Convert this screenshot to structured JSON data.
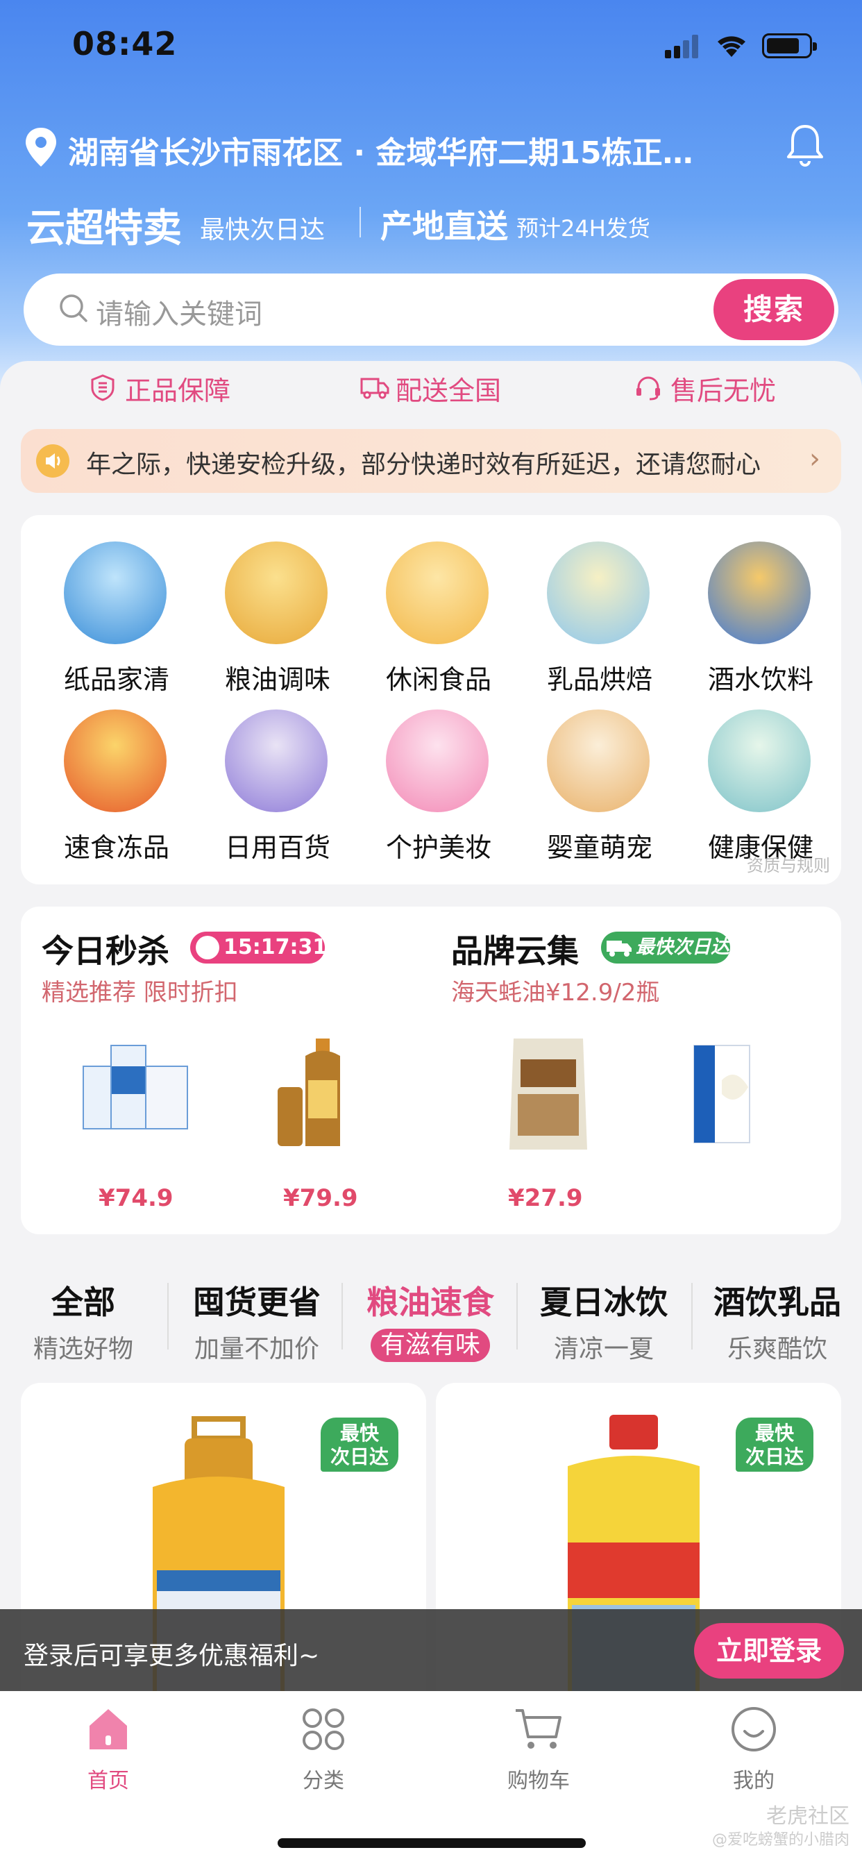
{
  "status_bar": {
    "time": "08:42"
  },
  "header": {
    "location": "湖南省长沙市雨花区 · 金域华府二期15栋正…",
    "brand_title": "云超特卖",
    "brand_sub": "最快次日达",
    "direct_title": "产地直送",
    "direct_sub": "预计24H发货"
  },
  "search": {
    "placeholder": "请输入关键词",
    "button": "搜索"
  },
  "guarantees": [
    "正品保障",
    "配送全国",
    "售后无忧"
  ],
  "notice": {
    "text": "年之际，快递安检升级，部分快递时效有所延迟，还请您耐心"
  },
  "categories": [
    {
      "label": "纸品家清",
      "icon": "tissue-icon",
      "color": "#3a8ed8"
    },
    {
      "label": "粮油调味",
      "icon": "oil-icon",
      "color": "#e8a93a"
    },
    {
      "label": "休闲食品",
      "icon": "snack-icon",
      "color": "#f3b84a"
    },
    {
      "label": "乳品烘焙",
      "icon": "cheese-icon",
      "color": "#8ec7ec"
    },
    {
      "label": "酒水饮料",
      "icon": "drink-icon",
      "color": "#3f79d6"
    },
    {
      "label": "速食冻品",
      "icon": "crayfish-icon",
      "color": "#e65a2b"
    },
    {
      "label": "日用百货",
      "icon": "pot-icon",
      "color": "#8e7bd8"
    },
    {
      "label": "个护美妆",
      "icon": "cosmetics-icon",
      "color": "#f38ab6"
    },
    {
      "label": "婴童萌宠",
      "icon": "diaper-icon",
      "color": "#e9b26b"
    },
    {
      "label": "健康保健",
      "icon": "mask-icon",
      "color": "#7fc3c9"
    }
  ],
  "categories_footer": "资质与规则",
  "deals": {
    "flash": {
      "title": "今日秒杀",
      "timer": "15:17:31",
      "sub": "精选推荐 限时折扣",
      "prices": [
        "¥74.9",
        "¥79.9"
      ]
    },
    "brand": {
      "title": "品牌云集",
      "badge": "最快次日达",
      "sub": "海天蚝油¥12.9/2瓶",
      "prices": [
        "¥27.9"
      ]
    }
  },
  "tabs": [
    {
      "title": "全部",
      "sub": "精选好物"
    },
    {
      "title": "囤货更省",
      "sub": "加量不加价"
    },
    {
      "title": "粮油速食",
      "sub": "有滋有味"
    },
    {
      "title": "夏日冰饮",
      "sub": "清凉一夏"
    },
    {
      "title": "酒饮乳品",
      "sub": "乐爽酷饮"
    }
  ],
  "product_badge": {
    "line1": "最快",
    "line2": "次日达"
  },
  "login_bar": {
    "text": "登录后可享更多优惠福利~",
    "button": "立即登录"
  },
  "tabbar": [
    "首页",
    "分类",
    "购物车",
    "我的"
  ],
  "watermark": {
    "line1": "老虎社区",
    "line2": "@爱吃螃蟹的小腊肉"
  }
}
